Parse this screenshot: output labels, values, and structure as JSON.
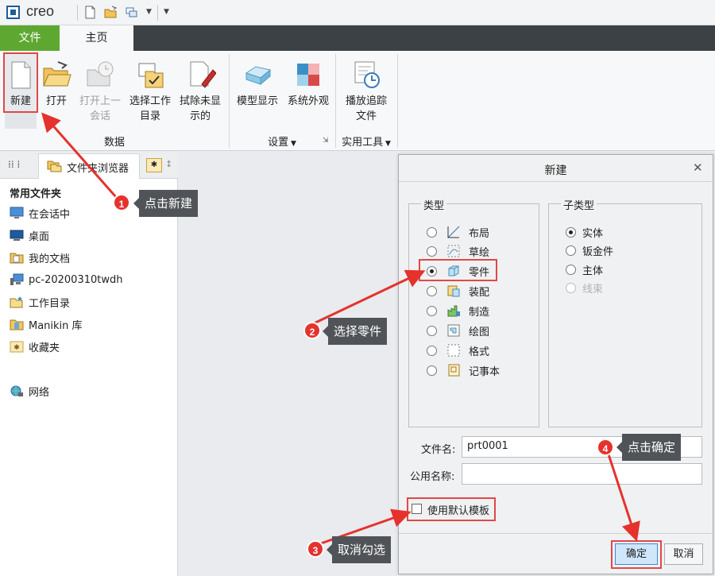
{
  "app": {
    "logo_text": "creo"
  },
  "tabs": {
    "file": "文件",
    "home": "主页"
  },
  "ribbon": {
    "new": "新建",
    "open": "打开",
    "open_last_1": "打开上一",
    "open_last_2": "会话",
    "select_dir_1": "选择工作",
    "select_dir_2": "目录",
    "erase_1": "拭除未显",
    "erase_2": "示的",
    "model_display": "模型显示",
    "system_appearance": "系统外观",
    "play_trail_1": "播放追踪",
    "play_trail_2": "文件",
    "group_data": "数据",
    "group_settings": "设置",
    "group_utilities": "实用工具"
  },
  "left_panel": {
    "tab_label": "文件夹浏览器",
    "favorites_title": "常用文件夹",
    "items": [
      "在会话中",
      "桌面",
      "我的文档",
      "pc-20200310twdh",
      "工作目录",
      "Manikin 库",
      "收藏夹"
    ],
    "network": "网络"
  },
  "dialog": {
    "title": "新建",
    "type_label": "类型",
    "types": [
      "布局",
      "草绘",
      "零件",
      "装配",
      "制造",
      "绘图",
      "格式",
      "记事本"
    ],
    "selected_type": "零件",
    "subtype_label": "子类型",
    "subtypes": [
      "实体",
      "钣金件",
      "主体",
      "线束"
    ],
    "selected_subtype": "实体",
    "filename_label": "文件名:",
    "filename_value": "prt0001",
    "common_name_label": "公用名称:",
    "common_name_value": "",
    "use_default_template": "使用默认模板",
    "ok": "确定",
    "cancel": "取消"
  },
  "annotations": [
    {
      "num": "1",
      "text": "点击新建"
    },
    {
      "num": "2",
      "text": "选择零件"
    },
    {
      "num": "3",
      "text": "取消勾选"
    },
    {
      "num": "4",
      "text": "点击确定"
    }
  ],
  "colors": {
    "file_tab": "#5ea832",
    "tab_bar": "#3c4146",
    "annotation_red": "#e5322d",
    "callout_bg": "#505458"
  }
}
